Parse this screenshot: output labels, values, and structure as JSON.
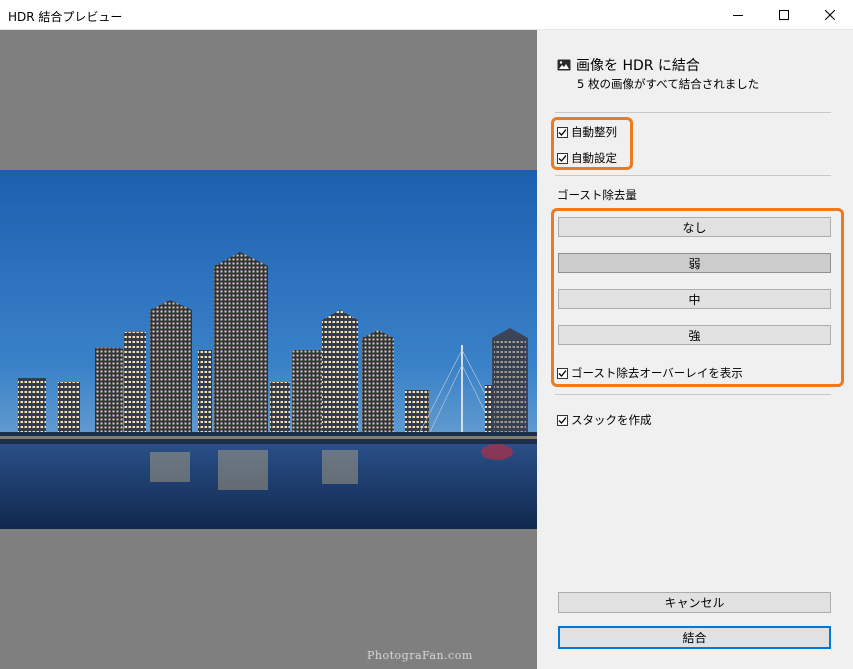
{
  "window": {
    "title": "HDR 結合プレビュー",
    "controls": [
      "minimize-icon",
      "maximize-icon",
      "close-icon"
    ]
  },
  "preview": {
    "watermark": "PhotograFan.com"
  },
  "panel": {
    "heading": "画像を HDR に結合",
    "subtext": "5 枚の画像がすべて結合されました",
    "auto_align": {
      "label": "自動整列",
      "checked": true
    },
    "auto_settings": {
      "label": "自動設定",
      "checked": true
    },
    "deghost_label": "ゴースト除去量",
    "deghost_options": [
      {
        "label": "なし",
        "selected": false
      },
      {
        "label": "弱",
        "selected": true
      },
      {
        "label": "中",
        "selected": false
      },
      {
        "label": "強",
        "selected": false
      }
    ],
    "show_overlay": {
      "label": "ゴースト除去オーバーレイを表示",
      "checked": true
    },
    "create_stack": {
      "label": "スタックを作成",
      "checked": true
    },
    "cancel_label": "キャンセル",
    "merge_label": "結合"
  },
  "colors": {
    "highlight": "#ee7a1f",
    "focus": "#0078d7"
  }
}
